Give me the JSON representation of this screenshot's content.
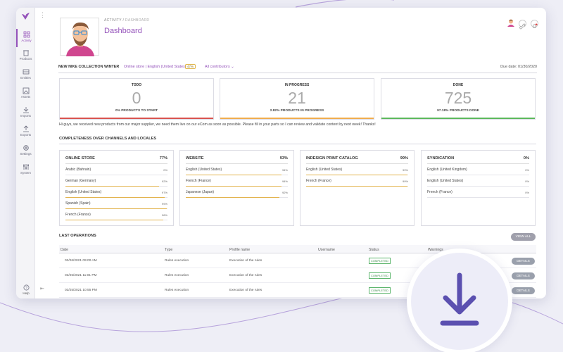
{
  "breadcrumb": {
    "parent": "ACTIVITY",
    "sep": "/",
    "current": "DASHBOARD"
  },
  "page_title": "Dashboard",
  "sidebar": {
    "items": [
      {
        "label": "Activity",
        "icon": "grid-icon",
        "active": true
      },
      {
        "label": "Products",
        "icon": "trash-icon",
        "active": false
      },
      {
        "label": "Entities",
        "icon": "entities-icon",
        "active": false
      },
      {
        "label": "Assets",
        "icon": "image-icon",
        "active": false
      },
      {
        "label": "Imports",
        "icon": "import-icon",
        "active": false
      },
      {
        "label": "Exports",
        "icon": "export-icon",
        "active": false
      },
      {
        "label": "Settings",
        "icon": "gear-icon",
        "active": false
      },
      {
        "label": "System",
        "icon": "sliders-icon",
        "active": false
      }
    ],
    "help": "Help"
  },
  "project": {
    "name": "NEW NIKE COLLECTION WINTER",
    "store": "Online store | English (United States)",
    "pct": "47%",
    "contributors": "All contributors",
    "due": "Due date: 01/30/2020"
  },
  "stats": [
    {
      "title": "TODO",
      "value": "0",
      "sub": "0% PRODUCTS TO START",
      "color": "#d9534f"
    },
    {
      "title": "IN PROGRESS",
      "value": "21",
      "sub": "2.82% PRODUCTS IN PROGRESS",
      "color": "#f0ad4e"
    },
    {
      "title": "DONE",
      "value": "725",
      "sub": "97.18% PRODUCTS DONE",
      "color": "#5cb85c"
    }
  ],
  "message": "Hi guys, we received new products from our major supplier, we need them live on our eCom as soon as possible. Please fill in your parts so I can review and validate content by next week! Thanks!",
  "completeness": {
    "title": "COMPLETENESS OVER CHANNELS AND LOCALES",
    "channels": [
      {
        "name": "ONLINE STORE",
        "pct": "77%",
        "locales": [
          {
            "name": "Arabic (Bahrain)",
            "pct": "0%",
            "fill": 0
          },
          {
            "name": "German (Germany)",
            "pct": "92%",
            "fill": 0.92
          },
          {
            "name": "English (United States)",
            "pct": "97%",
            "fill": 0.97
          },
          {
            "name": "Spanish (Spain)",
            "pct": "99%",
            "fill": 0.99
          },
          {
            "name": "French (France)",
            "pct": "96%",
            "fill": 0.96
          }
        ]
      },
      {
        "name": "WEBSITE",
        "pct": "93%",
        "locales": [
          {
            "name": "English (United States)",
            "pct": "94%",
            "fill": 0.94
          },
          {
            "name": "French (France)",
            "pct": "94%",
            "fill": 0.94
          },
          {
            "name": "Japanese (Japan)",
            "pct": "92%",
            "fill": 0.92
          }
        ]
      },
      {
        "name": "INDESIGN PRINT CATALOG",
        "pct": "99%",
        "locales": [
          {
            "name": "English (United States)",
            "pct": "99%",
            "fill": 0.99
          },
          {
            "name": "French (France)",
            "pct": "99%",
            "fill": 0.99
          }
        ]
      },
      {
        "name": "SYNDICATION",
        "pct": "0%",
        "locales": [
          {
            "name": "English (United Kingdom)",
            "pct": "0%",
            "fill": 0
          },
          {
            "name": "English (United States)",
            "pct": "0%",
            "fill": 0
          },
          {
            "name": "French (France)",
            "pct": "0%",
            "fill": 0
          }
        ]
      }
    ]
  },
  "operations": {
    "title": "LAST OPERATIONS",
    "view_all": "VIEW ALL",
    "columns": [
      "Date",
      "Type",
      "Profile name",
      "Username",
      "Status",
      "Warnings"
    ],
    "rows": [
      {
        "date": "03/26/2021 09:00 AM",
        "type": "Rules execution",
        "profile": "Execution of the rules",
        "username": "",
        "status": "COMPLETED",
        "action": "DETAILS"
      },
      {
        "date": "03/25/2021 11:01 PM",
        "type": "Rules execution",
        "profile": "Execution of the rules",
        "username": "",
        "status": "COMPLETED",
        "action": "DETAILS"
      },
      {
        "date": "03/25/2021 10:55 PM",
        "type": "Rules execution",
        "profile": "Execution of the rules",
        "username": "",
        "status": "COMPLETED",
        "action": "DETAILS"
      }
    ]
  },
  "colors": {
    "brand": "#9452ba",
    "download": "#5b50b0"
  }
}
